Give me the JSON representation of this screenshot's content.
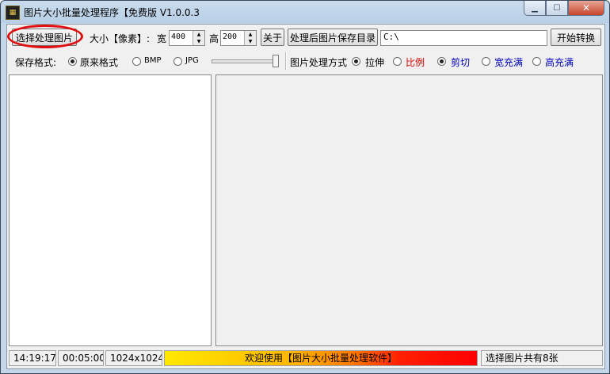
{
  "window": {
    "title": "图片大小批量处理程序【免费版 V1.0.0.3",
    "icon": "app-icon",
    "controls": [
      "minimize-icon",
      "maximize-icon",
      "close-icon"
    ]
  },
  "toolbar": {
    "select_button": "选择处理图片",
    "size_label": "大小【像素】:",
    "width_label": "宽",
    "width_value": "400",
    "height_label": "高",
    "height_value": "200",
    "lock_button": "关于",
    "save_dir_button": "处理后图片保存目录",
    "save_path": "C:\\",
    "start_button": "开始转换"
  },
  "options": {
    "format_label": "保存格式:",
    "formats": [
      {
        "label": "原来格式",
        "selected": true
      },
      {
        "label": "BMP",
        "selected": false
      },
      {
        "label": "JPG",
        "selected": false
      }
    ],
    "quality_level": 1.0,
    "method_label": "图片处理方式",
    "methods": [
      {
        "label": "拉伸",
        "selected": true,
        "color": "#000000"
      },
      {
        "label": "比例",
        "selected": false,
        "color": "#e00000"
      },
      {
        "label": "剪切",
        "selected": true,
        "color": "#0000c0"
      },
      {
        "label": "宽充满",
        "selected": false,
        "color": "#0000c0"
      },
      {
        "label": "高充满",
        "selected": false,
        "color": "#0000c0"
      }
    ]
  },
  "status": {
    "time": "14:19:17",
    "elapsed": "00:05:00",
    "resolution": "1024x1024",
    "welcome": "欢迎使用【图片大小批量处理软件】",
    "count_text": "选择图片共有8张"
  },
  "colors": {
    "highlight": "#e01010",
    "accent_blue": "#0000c0",
    "accent_red": "#e00000"
  }
}
